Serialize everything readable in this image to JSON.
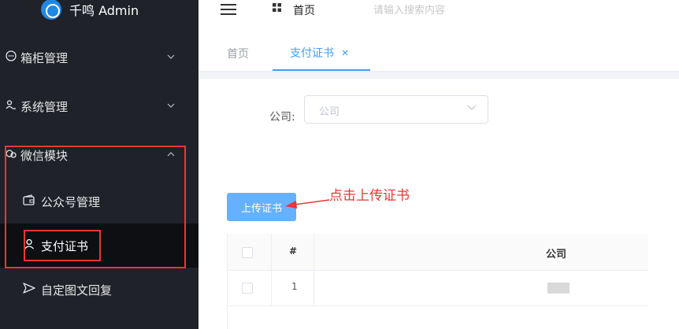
{
  "app": {
    "title": "千鸣 Admin"
  },
  "sidebar": {
    "items": [
      {
        "label": "箱柜管理",
        "icon": "chat-bubble-icon"
      },
      {
        "label": "系统管理",
        "icon": "user-group-icon"
      },
      {
        "label": "微信模块",
        "icon": "wechat-icon"
      }
    ],
    "subitems": [
      {
        "label": "公众号管理",
        "icon": "wallet-icon"
      },
      {
        "label": "支付证书",
        "icon": "user-icon",
        "active": true
      },
      {
        "label": "自定图文回复",
        "icon": "send-icon"
      }
    ]
  },
  "header": {
    "breadcrumb": "首页",
    "search_placeholder": "请输入搜索内容"
  },
  "tabs": [
    {
      "label": "首页"
    },
    {
      "label": "支付证书",
      "active": true
    }
  ],
  "filter": {
    "company_label": "公司:",
    "company_placeholder": "公司"
  },
  "actions": {
    "upload_label": "上传证书"
  },
  "annotation": {
    "text": "点击上传证书",
    "color": "#e53935"
  },
  "table": {
    "headers": [
      "#",
      "公司"
    ],
    "rows": [
      {
        "num": "1"
      }
    ]
  },
  "colors": {
    "sidebar_bg": "#1f2229",
    "accent": "#409eff",
    "button": "#66b1ff",
    "annotation": "#e53935"
  }
}
